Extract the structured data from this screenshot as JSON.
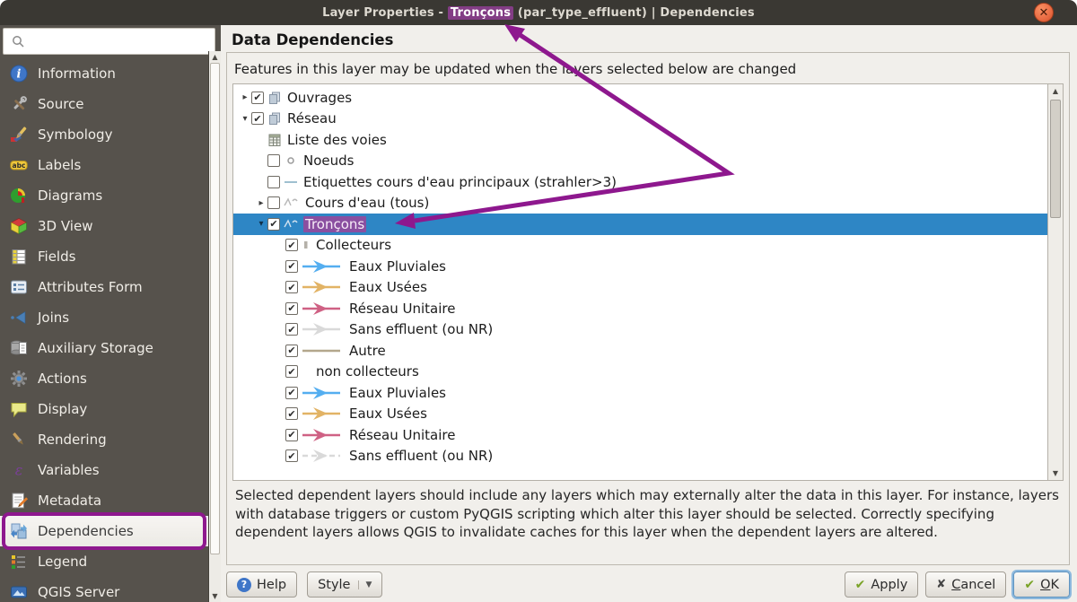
{
  "window": {
    "title_prefix": "Layer Properties - ",
    "title_highlight": "Tronçons",
    "title_suffix": " (par_type_effluent) | Dependencies",
    "close_icon": "x"
  },
  "sidebar": {
    "search_placeholder": "",
    "items": [
      {
        "label": "Information",
        "icon": "info-icon",
        "selected": false
      },
      {
        "label": "Source",
        "icon": "source-icon",
        "selected": false
      },
      {
        "label": "Symbology",
        "icon": "symbology-icon",
        "selected": false
      },
      {
        "label": "Labels",
        "icon": "labels-icon",
        "selected": false
      },
      {
        "label": "Diagrams",
        "icon": "diagrams-icon",
        "selected": false
      },
      {
        "label": "3D View",
        "icon": "3dview-icon",
        "selected": false
      },
      {
        "label": "Fields",
        "icon": "fields-icon",
        "selected": false
      },
      {
        "label": "Attributes Form",
        "icon": "form-icon",
        "selected": false
      },
      {
        "label": "Joins",
        "icon": "joins-icon",
        "selected": false
      },
      {
        "label": "Auxiliary Storage",
        "icon": "storage-icon",
        "selected": false
      },
      {
        "label": "Actions",
        "icon": "actions-icon",
        "selected": false
      },
      {
        "label": "Display",
        "icon": "display-icon",
        "selected": false
      },
      {
        "label": "Rendering",
        "icon": "rendering-icon",
        "selected": false
      },
      {
        "label": "Variables",
        "icon": "variables-icon",
        "selected": false
      },
      {
        "label": "Metadata",
        "icon": "metadata-icon",
        "selected": false
      },
      {
        "label": "Dependencies",
        "icon": "dependencies-icon",
        "selected": true,
        "annotated": true
      },
      {
        "label": "Legend",
        "icon": "legend-icon",
        "selected": false
      },
      {
        "label": "QGIS Server",
        "icon": "server-icon",
        "selected": false
      }
    ]
  },
  "main": {
    "heading": "Data Dependencies",
    "intro": "Features in this layer may be updated when the layers selected below are changed",
    "tree": [
      {
        "level": 0,
        "expander": "closed",
        "checkbox": "checked",
        "icon": "group-icon",
        "label": "Ouvrages",
        "selected": false
      },
      {
        "level": 0,
        "expander": "open",
        "checkbox": "checked",
        "icon": "group-icon",
        "label": "Réseau",
        "selected": false
      },
      {
        "level": 1,
        "expander": "none",
        "checkbox": "none",
        "icon": "table-icon",
        "label": "Liste des voies",
        "selected": false
      },
      {
        "level": 1,
        "expander": "none",
        "checkbox": "unchecked",
        "icon": "point-icon",
        "label": "Noeuds",
        "selected": false
      },
      {
        "level": 1,
        "expander": "none",
        "checkbox": "unchecked",
        "icon": "line-blue-icon",
        "label": "Etiquettes cours d'eau principaux (strahler>3)",
        "selected": false
      },
      {
        "level": 1,
        "expander": "closed",
        "checkbox": "unchecked",
        "icon": "squiggle-icon",
        "label": "Cours d'eau (tous)",
        "selected": false
      },
      {
        "level": 1,
        "expander": "open",
        "checkbox": "checked",
        "icon": "squiggle-light-icon",
        "label": "Tronçons",
        "selected": true,
        "label_highlighted": true
      },
      {
        "level": 2,
        "expander": "none",
        "checkbox": "checked",
        "icon": "small-rect-icon",
        "label": "Collecteurs",
        "selected": false
      },
      {
        "level": 3,
        "expander": "none",
        "checkbox": "checked",
        "icon": "arrow-blue-icon",
        "label": "Eaux Pluviales",
        "selected": false
      },
      {
        "level": 3,
        "expander": "none",
        "checkbox": "checked",
        "icon": "arrow-tan-icon",
        "label": "Eaux Usées",
        "selected": false
      },
      {
        "level": 3,
        "expander": "none",
        "checkbox": "checked",
        "icon": "arrow-pink-icon",
        "label": "Réseau Unitaire",
        "selected": false
      },
      {
        "level": 3,
        "expander": "none",
        "checkbox": "checked",
        "icon": "arrow-gray-icon",
        "label": "Sans effluent (ou NR)",
        "selected": false
      },
      {
        "level": 3,
        "expander": "none",
        "checkbox": "checked",
        "icon": "line-tan-icon",
        "label": "Autre",
        "selected": false
      },
      {
        "level": 2,
        "expander": "none",
        "checkbox": "checked",
        "icon": "none",
        "label": "non collecteurs",
        "selected": false
      },
      {
        "level": 3,
        "expander": "none",
        "checkbox": "checked",
        "icon": "arrow-blue-icon",
        "label": "Eaux Pluviales",
        "selected": false
      },
      {
        "level": 3,
        "expander": "none",
        "checkbox": "checked",
        "icon": "arrow-tan-icon",
        "label": "Eaux Usées",
        "selected": false
      },
      {
        "level": 3,
        "expander": "none",
        "checkbox": "checked",
        "icon": "arrow-pink-icon",
        "label": "Réseau Unitaire",
        "selected": false
      },
      {
        "level": 3,
        "expander": "none",
        "checkbox": "checked",
        "icon": "arrow-gray-dash-icon",
        "label": "Sans effluent (ou NR)",
        "selected": false
      }
    ],
    "description": "Selected dependent layers should include any layers which may externally alter the data in this layer. For instance, layers with database triggers or custom PyQGIS scripting which alter this layer should be selected. Correctly specifying dependent layers allows QGIS to invalidate caches for this layer when the dependent layers are altered."
  },
  "footer": {
    "help": "Help",
    "style": "Style",
    "apply": "Apply",
    "cancel_mnemonic": "C",
    "cancel_rest": "ancel",
    "ok_mnemonic": "O",
    "ok_rest": "K"
  },
  "colors": {
    "selection_blue": "#2e86c5",
    "annotation_purple": "#8e188e",
    "arrow_blue": "#54aef0",
    "arrow_tan": "#e2b365",
    "arrow_pink": "#cf6184",
    "arrow_gray": "#d9d9d9",
    "line_tan": "#b3a78c",
    "close_orange": "#e96b43",
    "titlebar_bg": "#3a3833",
    "sidebar_bg": "#56524c"
  }
}
